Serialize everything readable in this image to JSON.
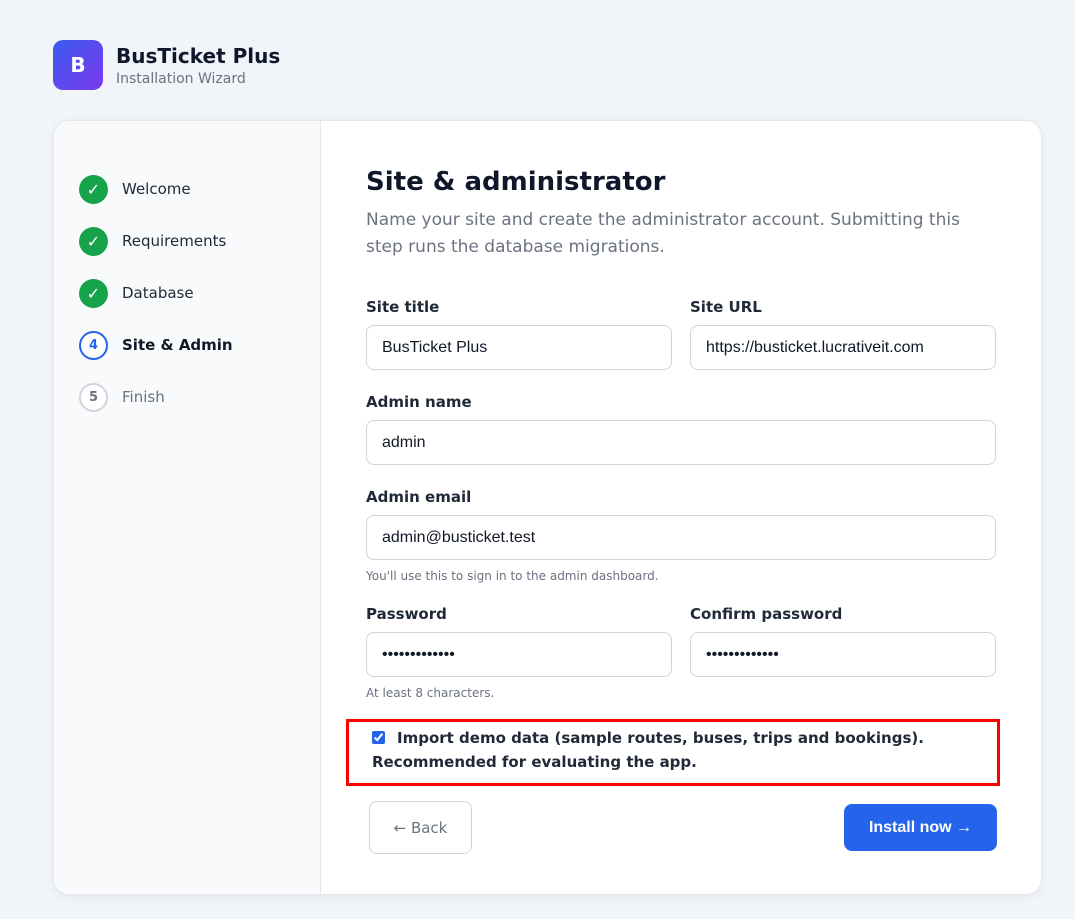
{
  "brand": {
    "logo_letter": "B",
    "name": "BusTicket Plus",
    "subtitle": "Installation Wizard"
  },
  "steps": [
    {
      "number": "✓",
      "label": "Welcome",
      "status": "done"
    },
    {
      "number": "✓",
      "label": "Requirements",
      "status": "done"
    },
    {
      "number": "✓",
      "label": "Database",
      "status": "done"
    },
    {
      "number": "4",
      "label": "Site & Admin",
      "status": "current"
    },
    {
      "number": "5",
      "label": "Finish",
      "status": "pending"
    }
  ],
  "form": {
    "title": "Site & administrator",
    "description": "Name your site and create the administrator account. Submitting this step runs the database migrations.",
    "site_title": {
      "label": "Site title",
      "value": "BusTicket Plus"
    },
    "site_url": {
      "label": "Site URL",
      "value": "https://busticket.lucrativeit.com"
    },
    "admin_name": {
      "label": "Admin name",
      "value": "admin"
    },
    "admin_email": {
      "label": "Admin email",
      "value": "admin@busticket.test",
      "hint": "You'll use this to sign in to the admin dashboard."
    },
    "password": {
      "label": "Password",
      "value": "passwordpass1",
      "hint": "At least 8 characters."
    },
    "confirm_password": {
      "label": "Confirm password",
      "value": "passwordpass1"
    },
    "demo_data": {
      "label": "Import demo data (sample routes, buses, trips and bookings). Recommended for evaluating the app.",
      "checked": true
    },
    "back_label": "← Back",
    "install_label": "Install now →"
  },
  "colors": {
    "accent": "#2563eb",
    "done": "#16a34a",
    "highlight": "#ff0000"
  }
}
